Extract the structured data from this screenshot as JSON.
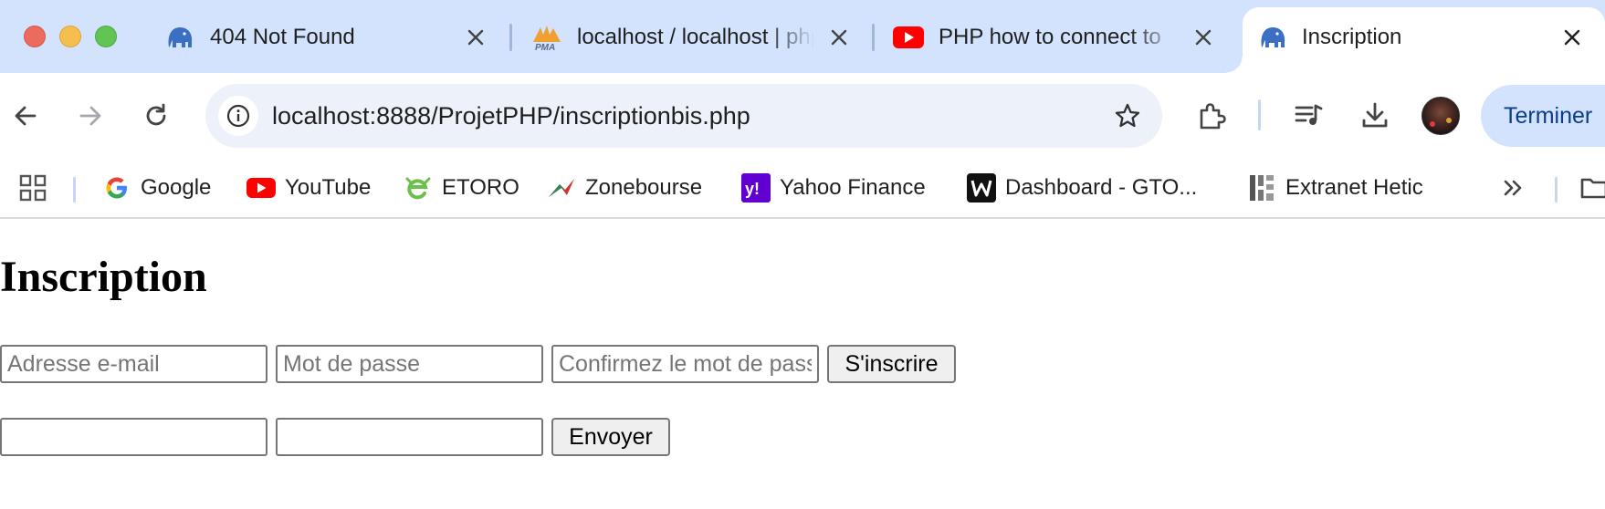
{
  "window": {
    "controls": [
      "close",
      "minimize",
      "zoom"
    ]
  },
  "tabs": [
    {
      "title": "404 Not Found",
      "icon": "mamp-elephant-icon",
      "active": false
    },
    {
      "title": "localhost / localhost | phpMyAdmin",
      "icon": "phpmyadmin-icon",
      "active": false
    },
    {
      "title": "PHP how to connect to",
      "icon": "youtube-icon",
      "active": false
    },
    {
      "title": "Inscription",
      "icon": "mamp-elephant-icon",
      "active": true
    }
  ],
  "toolbar": {
    "url": "localhost:8888/ProjetPHP/inscriptionbis.php",
    "profile_button_label": "Terminer"
  },
  "bookmarks": [
    {
      "label": "Google",
      "icon": "google-icon"
    },
    {
      "label": "YouTube",
      "icon": "youtube-icon"
    },
    {
      "label": "ETORO",
      "icon": "etoro-icon"
    },
    {
      "label": "Zonebourse",
      "icon": "zonebourse-icon"
    },
    {
      "label": "Yahoo Finance",
      "icon": "yahoo-icon"
    },
    {
      "label": "Dashboard - GTO...",
      "icon": "w-logo-icon"
    },
    {
      "label": "Extranet Hetic",
      "icon": "hetic-icon"
    }
  ],
  "page": {
    "heading": "Inscription",
    "signup_form": {
      "email_placeholder": "Adresse e-mail",
      "password_placeholder": "Mot de passe",
      "confirm_placeholder": "Confirmez le mot de passe",
      "email_value": "",
      "password_value": "",
      "confirm_value": "",
      "submit_label": "S'inscrire"
    },
    "second_form": {
      "field1_value": "",
      "field2_value": "",
      "submit_label": "Envoyer"
    }
  },
  "colors": {
    "tabstrip_bg": "#d3e3fd",
    "omnibox_bg": "#ecf1fa",
    "accent_text": "#0b3e8a",
    "youtube_red": "#ff0000"
  }
}
